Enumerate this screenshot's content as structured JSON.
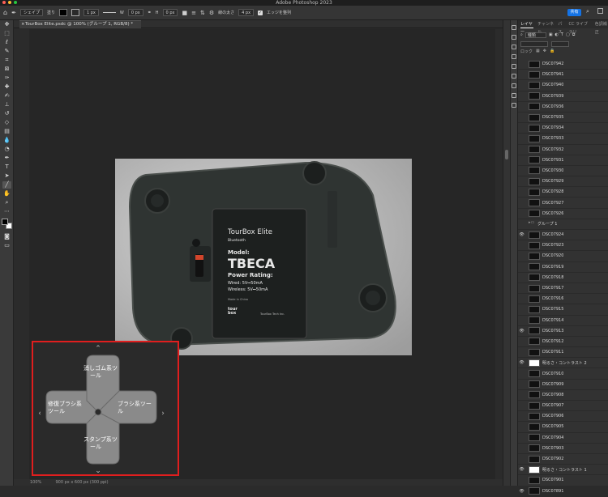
{
  "app": {
    "title": "Adobe Photoshop 2023",
    "traffic_lights": [
      "#ff5f57",
      "#febc2e",
      "#28c840"
    ]
  },
  "options_bar": {
    "shape_mode": "シェイプ",
    "fill_label": "塗り",
    "stroke_width": "1 px",
    "w_label": "W",
    "w_value": "0 px",
    "h_label": "H",
    "h_value": "0 px",
    "weight_label": "線の太さ",
    "weight_value": "4 px",
    "align_edges_label": "エッジを整列",
    "share_label": "共有"
  },
  "document": {
    "tab_title": "TourBox Elite.psdc @ 100% (グループ 1, RGB/8) *",
    "status_zoom": "100%",
    "status_info": "900 px x 600 px (300 ppi)"
  },
  "photo_labels": {
    "brand": "TourBox Elite",
    "bluetooth": "Bluetooth",
    "model_label": "Model:",
    "model": "TBECA",
    "power": "Power Rating:",
    "wired": "Wired: 5V⎓50mA",
    "wireless": "Wireless: 5V⎓50mA",
    "made": "Made in China",
    "footer_right": "TourBox Tech Inc.",
    "logo_mark": "tour box"
  },
  "overlay": {
    "up": "消しゴム系ツール",
    "right": "ブラシ系ツール",
    "down": "スタンプ系ツール",
    "left": "修復ブラシ系ツール",
    "up_line1": "消しゴム系ツ",
    "up_line2": "ール",
    "right_line1": "ブラシ系ツー",
    "right_line2": "ル",
    "down_line1": "スタンプ系ツ",
    "down_line2": "ール",
    "left_line1": "修復ブラシ系",
    "left_line2": "ツール"
  },
  "panel": {
    "tabs": [
      "レイヤー",
      "チャンネル",
      "パス",
      "CC ライブラリ",
      "色調補正"
    ],
    "filter_label": "種類",
    "lock_label": "ロック",
    "layers": [
      {
        "name": "DSC07942",
        "type": "image",
        "visible": false
      },
      {
        "name": "DSC07941",
        "type": "image",
        "visible": false
      },
      {
        "name": "DSC07940",
        "type": "image",
        "visible": false
      },
      {
        "name": "DSC07939",
        "type": "image",
        "visible": false
      },
      {
        "name": "DSC07936",
        "type": "image",
        "visible": false
      },
      {
        "name": "DSC07935",
        "type": "image",
        "visible": false
      },
      {
        "name": "DSC07934",
        "type": "image",
        "visible": false
      },
      {
        "name": "DSC07933",
        "type": "image",
        "visible": false
      },
      {
        "name": "DSC07932",
        "type": "image",
        "visible": false
      },
      {
        "name": "DSC07931",
        "type": "image",
        "visible": false
      },
      {
        "name": "DSC07930",
        "type": "image",
        "visible": false
      },
      {
        "name": "DSC07929",
        "type": "image",
        "visible": false
      },
      {
        "name": "DSC07928",
        "type": "image",
        "visible": false
      },
      {
        "name": "DSC07927",
        "type": "image",
        "visible": false
      },
      {
        "name": "DSC07926",
        "type": "image",
        "visible": false
      },
      {
        "name": "グループ 1",
        "type": "group",
        "visible": false
      },
      {
        "name": "DSC07924",
        "type": "image",
        "visible": true
      },
      {
        "name": "DSC07923",
        "type": "image",
        "visible": false
      },
      {
        "name": "DSC07920",
        "type": "image",
        "visible": false
      },
      {
        "name": "DSC07919",
        "type": "image",
        "visible": false
      },
      {
        "name": "DSC07918",
        "type": "image",
        "visible": false
      },
      {
        "name": "DSC07917",
        "type": "image",
        "visible": false
      },
      {
        "name": "DSC07916",
        "type": "image",
        "visible": false
      },
      {
        "name": "DSC07915",
        "type": "image",
        "visible": false
      },
      {
        "name": "DSC07914",
        "type": "image",
        "visible": false
      },
      {
        "name": "DSC07913",
        "type": "image",
        "visible": true
      },
      {
        "name": "DSC07912",
        "type": "image",
        "visible": false
      },
      {
        "name": "DSC07911",
        "type": "image",
        "visible": false
      },
      {
        "name": "明るさ・コントラスト 2",
        "type": "adjustment",
        "visible": true
      },
      {
        "name": "DSC07910",
        "type": "image",
        "visible": false
      },
      {
        "name": "DSC07909",
        "type": "image",
        "visible": false
      },
      {
        "name": "DSC07908",
        "type": "image",
        "visible": false
      },
      {
        "name": "DSC07907",
        "type": "image",
        "visible": false
      },
      {
        "name": "DSC07906",
        "type": "image",
        "visible": false
      },
      {
        "name": "DSC07905",
        "type": "image",
        "visible": false
      },
      {
        "name": "DSC07904",
        "type": "image",
        "visible": false
      },
      {
        "name": "DSC07903",
        "type": "image",
        "visible": false
      },
      {
        "name": "DSC07902",
        "type": "image",
        "visible": false
      },
      {
        "name": "明るさ・コントラスト 1",
        "type": "adjustment",
        "visible": true
      },
      {
        "name": "DSC07901",
        "type": "image",
        "visible": false
      },
      {
        "name": "DSC07891",
        "type": "image",
        "visible": true
      }
    ]
  },
  "colors": {
    "highlight_border": "#e01e1e",
    "accent": "#1473e6"
  }
}
